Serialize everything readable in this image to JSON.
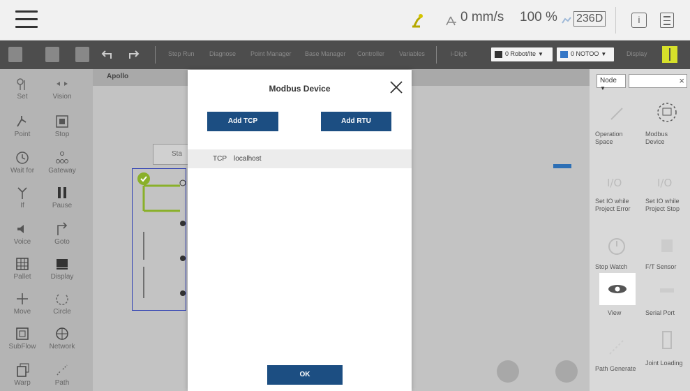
{
  "status": {
    "speed": "0 mm/s",
    "percent": "100 %",
    "box": "236D"
  },
  "toolbar": {
    "items": [
      "Step Run",
      "Diagnose",
      "Point Manager",
      "Base Manager",
      "Controller",
      "Variables"
    ],
    "i_digit": "i-Digit",
    "robot_dropdown": "0 Robot/Ite",
    "notoo_dropdown": "0 NOTOO",
    "display": "Display"
  },
  "palette": [
    {
      "label": "Set",
      "icon": "set-icon"
    },
    {
      "label": "Vision",
      "icon": "vision-icon"
    },
    {
      "label": "Point",
      "icon": "point-icon"
    },
    {
      "label": "Stop",
      "icon": "stop-icon"
    },
    {
      "label": "Wait for",
      "icon": "wait-for-icon"
    },
    {
      "label": "Gateway",
      "icon": "gateway-icon"
    },
    {
      "label": "If",
      "icon": "if-icon"
    },
    {
      "label": "Pause",
      "icon": "pause-icon"
    },
    {
      "label": "Voice",
      "icon": "voice-icon"
    },
    {
      "label": "Goto",
      "icon": "goto-icon"
    },
    {
      "label": "Pallet",
      "icon": "pallet-icon"
    },
    {
      "label": "Display",
      "icon": "display-icon"
    },
    {
      "label": "Move",
      "icon": "move-icon"
    },
    {
      "label": "Circle",
      "icon": "circle-icon"
    },
    {
      "label": "SubFlow",
      "icon": "subflow-icon"
    },
    {
      "label": "Network",
      "icon": "network-icon"
    },
    {
      "label": "Warp",
      "icon": "warp-icon"
    },
    {
      "label": "Path",
      "icon": "path-icon"
    }
  ],
  "canvas": {
    "tab": "Apollo",
    "start_label": "Sta"
  },
  "right_panel": {
    "filter": "Node",
    "items": [
      {
        "label": "Operation Space",
        "icon": "operation-space-icon"
      },
      {
        "label": "Modbus Device",
        "icon": "modbus-device-icon"
      },
      {
        "label": "Set IO while Project Error",
        "icon": "set-io-error-icon"
      },
      {
        "label": "Set IO while Project Stop",
        "icon": "set-io-stop-icon"
      },
      {
        "label": "Stop Watch",
        "icon": "stop-watch-icon"
      },
      {
        "label": "F/T Sensor",
        "icon": "ft-sensor-icon"
      },
      {
        "label": "View",
        "icon": "view-icon"
      },
      {
        "label": "Serial Port",
        "icon": "serial-port-icon"
      },
      {
        "label": "Path Generate",
        "icon": "path-generate-icon"
      },
      {
        "label": "Joint Loading",
        "icon": "joint-loading-icon"
      }
    ]
  },
  "modal": {
    "title": "Modbus Device",
    "add_tcp": "Add TCP",
    "add_rtu": "Add RTU",
    "devices": [
      {
        "type": "TCP",
        "name": "localhost"
      }
    ],
    "ok": "OK"
  }
}
